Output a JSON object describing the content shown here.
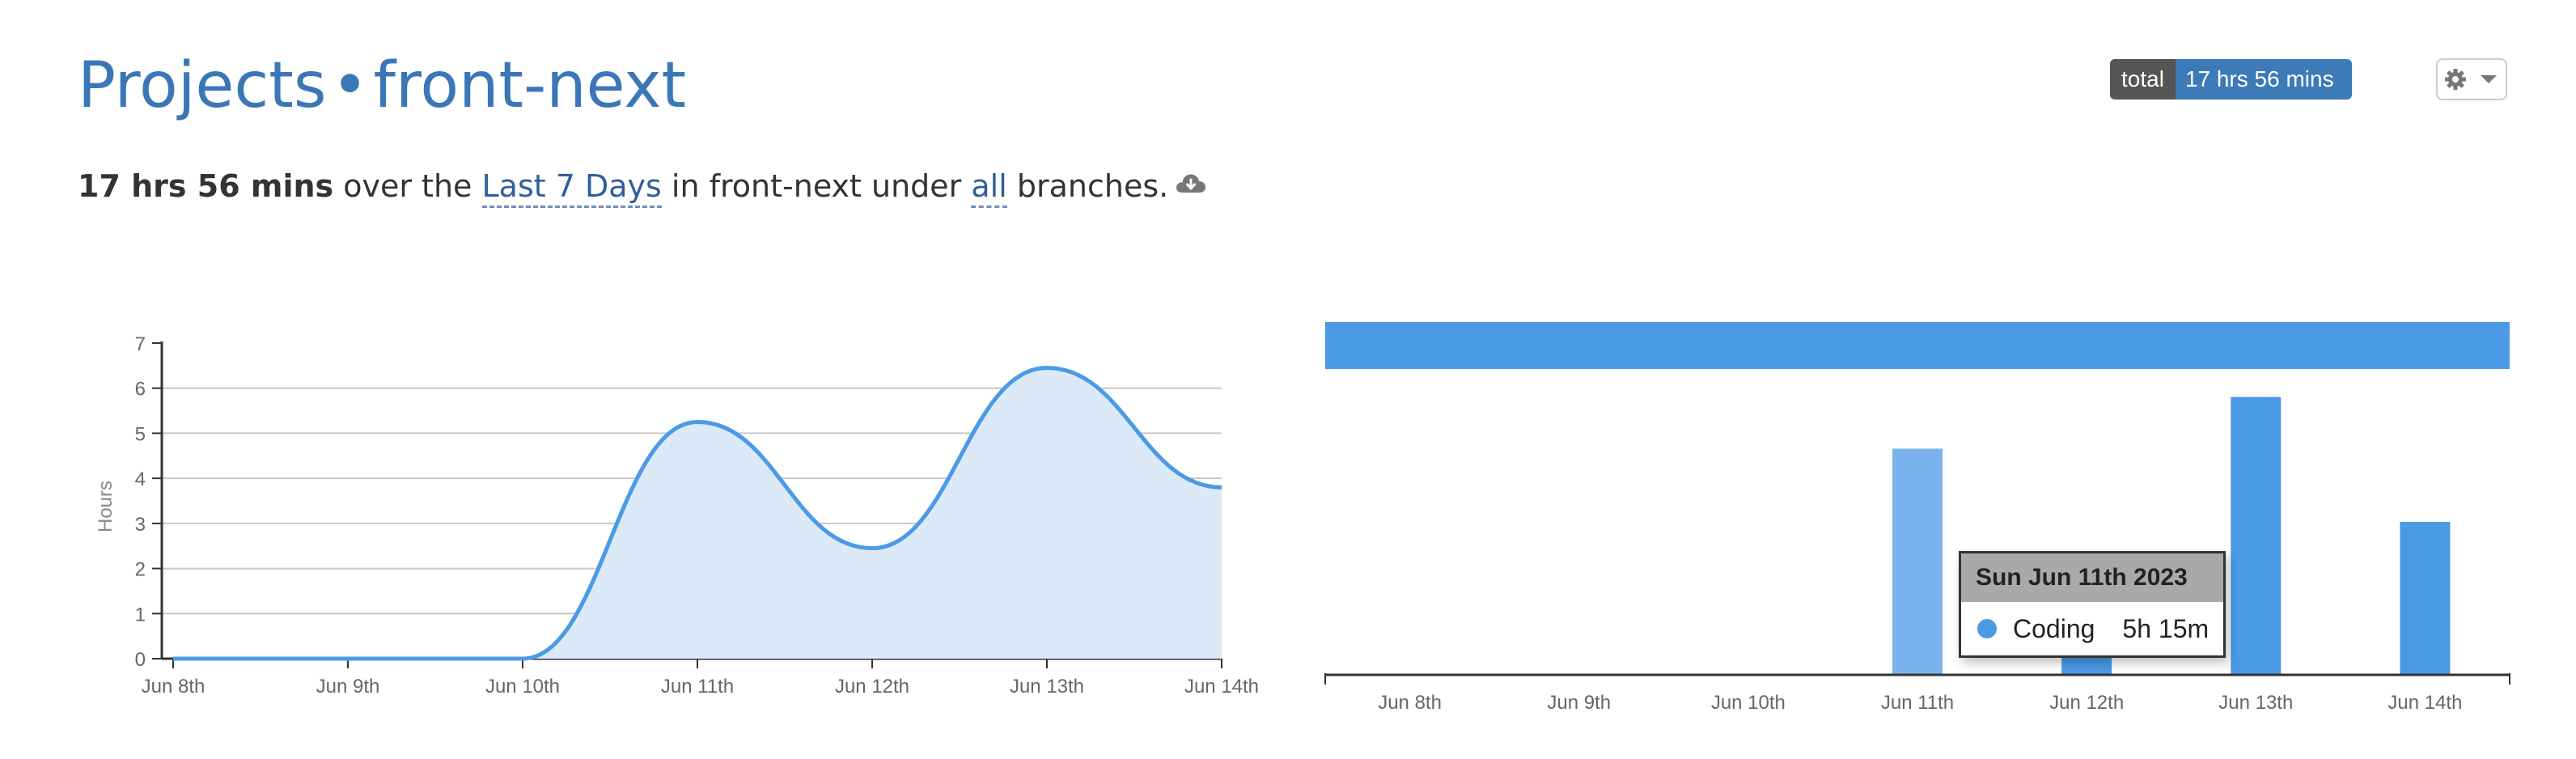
{
  "header": {
    "title_projects": "Projects",
    "title_separator": "•",
    "title_project": "front-next"
  },
  "summary": {
    "total": "17 hrs 56 mins",
    "text_over": " over the ",
    "range_link": "Last 7 Days",
    "text_in": " in front-next under ",
    "branch_link": "all",
    "text_branches": " branches."
  },
  "total_badge": {
    "label": "total",
    "value": "17 hrs 56 mins"
  },
  "settings": {
    "icon": "gear-icon",
    "caret_icon": "caret-down-icon"
  },
  "download_icon": "cloud-download-icon",
  "colors": {
    "brand_blue": "#3b77b7",
    "series_blue": "#4a9ae6",
    "area_fill": "#dce9f8",
    "highlight_bar": "#7ab4ee"
  },
  "tooltip": {
    "date": "Sun Jun 11th 2023",
    "category": "Coding",
    "duration": "5h 15m"
  },
  "chart_data": [
    {
      "type": "area",
      "categories": [
        "Jun 8th",
        "Jun 9th",
        "Jun 10th",
        "Jun 11th",
        "Jun 12th",
        "Jun 13th",
        "Jun 14th"
      ],
      "series": [
        {
          "values": [
            0,
            0,
            0,
            5.25,
            2.45,
            6.45,
            3.8
          ]
        }
      ],
      "ylabel": "Hours",
      "ylim": [
        0,
        7
      ],
      "yticks": [
        0,
        1,
        2,
        3,
        4,
        5,
        6,
        7
      ],
      "grid": true
    },
    {
      "type": "bar",
      "categories": [
        "Jun 8th",
        "Jun 9th",
        "Jun 10th",
        "Jun 11th",
        "Jun 12th",
        "Jun 13th",
        "Jun 14th"
      ],
      "series": [
        {
          "name": "Coding",
          "values": [
            0,
            0,
            0,
            5.25,
            1.5,
            6.45,
            3.55
          ]
        }
      ],
      "highlighted_category": "Jun 11th",
      "legend": "top"
    }
  ]
}
